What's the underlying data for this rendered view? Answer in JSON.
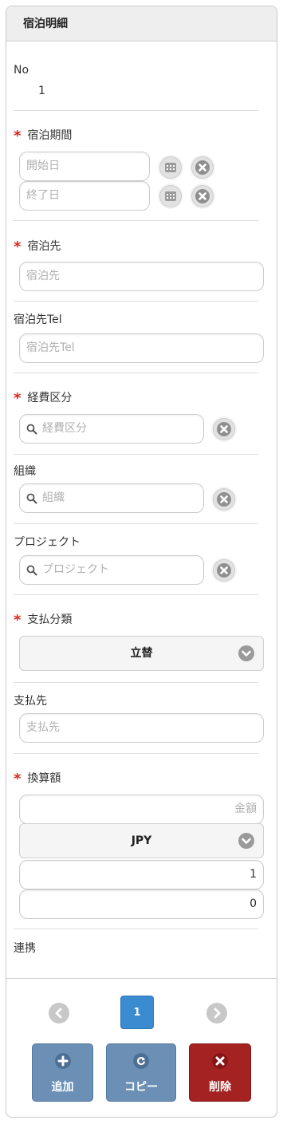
{
  "header": {
    "title": "宿泊明細"
  },
  "no": {
    "label": "No",
    "value": "1"
  },
  "period": {
    "label": "宿泊期間",
    "required_mark": "*",
    "start_placeholder": "開始日",
    "end_placeholder": "終了日"
  },
  "hotel": {
    "label": "宿泊先",
    "required_mark": "*",
    "placeholder": "宿泊先"
  },
  "hotel_tel": {
    "label": "宿泊先Tel",
    "placeholder": "宿泊先Tel"
  },
  "expense_category": {
    "label": "経費区分",
    "required_mark": "*",
    "placeholder": "経費区分"
  },
  "organization": {
    "label": "組織",
    "placeholder": "組織"
  },
  "project": {
    "label": "プロジェクト",
    "placeholder": "プロジェクト"
  },
  "payment_type": {
    "label": "支払分類",
    "required_mark": "*",
    "selected": "立替"
  },
  "payee": {
    "label": "支払先",
    "placeholder": "支払先"
  },
  "converted_amount": {
    "label": "換算額",
    "required_mark": "*",
    "amount_placeholder": "金額",
    "currency": "JPY",
    "rate": "1",
    "total": "0"
  },
  "link": {
    "label": "連携"
  },
  "pager": {
    "current_page": "1"
  },
  "actions": {
    "add_label": "追加",
    "copy_label": "コピー",
    "delete_label": "削除"
  },
  "colors": {
    "required": "#d9261c",
    "page_active": "#3a8bd0",
    "button_blue": "#6b8fb5",
    "button_red": "#a52222"
  }
}
